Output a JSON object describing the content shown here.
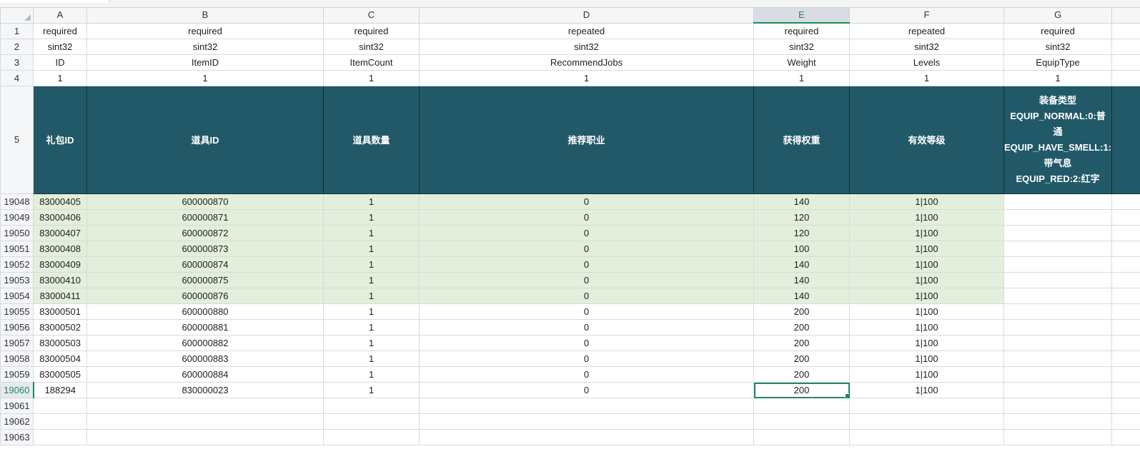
{
  "columns": [
    "A",
    "B",
    "C",
    "D",
    "E",
    "F",
    "G"
  ],
  "selected_column": "E",
  "meta_rows": [
    {
      "row": "1",
      "cells": [
        "required",
        "required",
        "required",
        "repeated",
        "required",
        "repeated",
        "required"
      ]
    },
    {
      "row": "2",
      "cells": [
        "sint32",
        "sint32",
        "sint32",
        "sint32",
        "sint32",
        "sint32",
        "sint32"
      ]
    },
    {
      "row": "3",
      "cells": [
        "ID",
        "ItemID",
        "ItemCount",
        "RecommendJobs",
        "Weight",
        "Levels",
        "EquipType"
      ]
    },
    {
      "row": "4",
      "cells": [
        "1",
        "1",
        "1",
        "1",
        "1",
        "1",
        "1"
      ]
    }
  ],
  "header_row": {
    "row": "5",
    "cells": [
      "礼包ID",
      "道具ID",
      "道具数量",
      "推荐职业",
      "获得权重",
      "有效等级"
    ],
    "equip_lines": [
      "装备类型",
      "EQUIP_NORMAL:0:普",
      "通",
      "EQUIP_HAVE_SMELL:1:",
      "带气息",
      "EQUIP_RED:2:红字"
    ]
  },
  "data_rows": [
    {
      "row": "19048",
      "cells": [
        "83000405",
        "600000870",
        "1",
        "0",
        "140",
        "1|100",
        ""
      ],
      "highlight": true
    },
    {
      "row": "19049",
      "cells": [
        "83000406",
        "600000871",
        "1",
        "0",
        "120",
        "1|100",
        ""
      ],
      "highlight": true
    },
    {
      "row": "19050",
      "cells": [
        "83000407",
        "600000872",
        "1",
        "0",
        "120",
        "1|100",
        ""
      ],
      "highlight": true
    },
    {
      "row": "19051",
      "cells": [
        "83000408",
        "600000873",
        "1",
        "0",
        "100",
        "1|100",
        ""
      ],
      "highlight": true
    },
    {
      "row": "19052",
      "cells": [
        "83000409",
        "600000874",
        "1",
        "0",
        "140",
        "1|100",
        ""
      ],
      "highlight": true
    },
    {
      "row": "19053",
      "cells": [
        "83000410",
        "600000875",
        "1",
        "0",
        "140",
        "1|100",
        ""
      ],
      "highlight": true
    },
    {
      "row": "19054",
      "cells": [
        "83000411",
        "600000876",
        "1",
        "0",
        "140",
        "1|100",
        ""
      ],
      "highlight": true
    },
    {
      "row": "19055",
      "cells": [
        "83000501",
        "600000880",
        "1",
        "0",
        "200",
        "1|100",
        ""
      ],
      "highlight": false
    },
    {
      "row": "19056",
      "cells": [
        "83000502",
        "600000881",
        "1",
        "0",
        "200",
        "1|100",
        ""
      ],
      "highlight": false
    },
    {
      "row": "19057",
      "cells": [
        "83000503",
        "600000882",
        "1",
        "0",
        "200",
        "1|100",
        ""
      ],
      "highlight": false
    },
    {
      "row": "19058",
      "cells": [
        "83000504",
        "600000883",
        "1",
        "0",
        "200",
        "1|100",
        ""
      ],
      "highlight": false
    },
    {
      "row": "19059",
      "cells": [
        "83000505",
        "600000884",
        "1",
        "0",
        "200",
        "1|100",
        ""
      ],
      "highlight": false
    },
    {
      "row": "19060",
      "cells": [
        "188294",
        "830000023",
        "1",
        "0",
        "200",
        "1|100",
        ""
      ],
      "highlight": false,
      "selected": true
    },
    {
      "row": "19061",
      "cells": [
        "",
        "",
        "",
        "",
        "",
        "",
        ""
      ],
      "highlight": false
    },
    {
      "row": "19062",
      "cells": [
        "",
        "",
        "",
        "",
        "",
        "",
        ""
      ],
      "highlight": false
    },
    {
      "row": "19063",
      "cells": [
        "",
        "",
        "",
        "",
        "",
        "",
        ""
      ],
      "highlight": false
    }
  ],
  "active_cell": {
    "row": "19060",
    "column": "E"
  },
  "colors": {
    "header_fill": "#215968",
    "highlight_fill": "#e2efda",
    "selection": "#1f8a5a"
  }
}
